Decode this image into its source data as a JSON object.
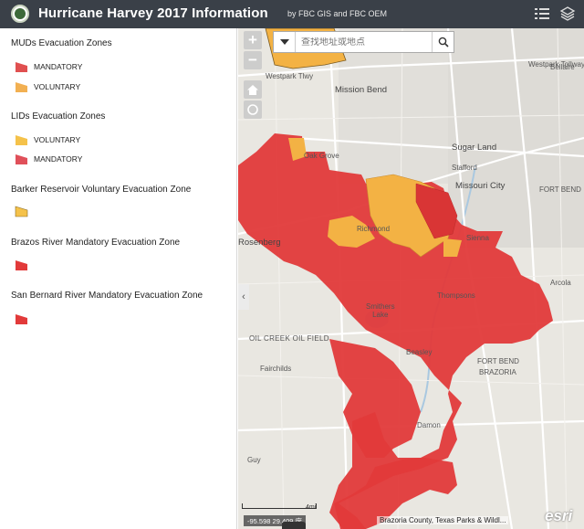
{
  "header": {
    "title": "Hurricane Harvey 2017 Information",
    "subtitle": "by FBC GIS and FBC OEM",
    "logo_icon": "county-seal-icon",
    "legend_button_icon": "legend-list-icon",
    "layers_button_icon": "layers-icon",
    "background": "#3a4048"
  },
  "legend": {
    "sections": [
      {
        "title": "MUDs Evacuation Zones",
        "items": [
          {
            "label": "MANDATORY",
            "color": "#e05050"
          },
          {
            "label": "VOLUNTARY",
            "color": "#f2b052"
          }
        ]
      },
      {
        "title": "LIDs Evacuation Zones",
        "items": [
          {
            "label": "VOLUNTARY",
            "color": "#f5c24a"
          },
          {
            "label": "MANDATORY",
            "color": "#e0505a"
          }
        ]
      },
      {
        "title": "Barker Reservoir Voluntary Evacuation Zone",
        "items": [
          {
            "label": "",
            "color": "#f5c24a"
          }
        ]
      },
      {
        "title": "Brazos River Mandatory Evacuation Zone",
        "items": [
          {
            "label": "",
            "color": "#e23a3a"
          }
        ]
      },
      {
        "title": "San Bernard River Mandatory Evacuation Zone",
        "items": [
          {
            "label": "",
            "color": "#e23a3a"
          }
        ]
      }
    ]
  },
  "map": {
    "search": {
      "placeholder": "查找地址或地点"
    },
    "labels": {
      "westpark_tollway": "Westpark Tollway",
      "westpark_tlwy": "Westpark Tlwy",
      "mission_bend": "Mission Bend",
      "bellaire": "Bellaire",
      "sugar_land": "Sugar Land",
      "stafford": "Stafford",
      "missouri_city": "Missouri City",
      "fort_bend": "FORT BEND",
      "sienna": "Sienna",
      "arcola": "Arcola",
      "rosenberg": "Rosenberg",
      "oak_grove": "Oak Grove",
      "richmond": "Richmond",
      "smithers_lake": "Smithers\nLake",
      "thompsons": "Thompsons",
      "oil_creek": "OIL CREEK OIL FIELD",
      "fairchilds": "Fairchilds",
      "brazoria": "BRAZORIA",
      "fort_bend_2": "FORT BEND",
      "guy": "Guy",
      "nada": "Damon",
      "beasley": "Beasley"
    },
    "scale_label": "4mi",
    "coords": "-95.598 29.409 度",
    "attribution": "Brazoria County, Texas Parks & Wildl...",
    "esri_logo": "esri",
    "colors": {
      "mandatory": "#e23a3a",
      "voluntary": "#f3b244",
      "water": "#a9c8e0",
      "land": "#e9e7e1",
      "road": "#ffffff"
    }
  }
}
